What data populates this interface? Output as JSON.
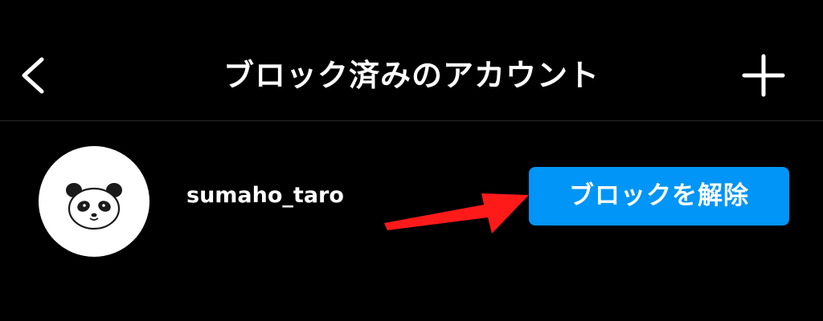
{
  "header": {
    "title": "ブロック済みのアカウント",
    "back_icon": "chevron-left-icon",
    "add_icon": "plus-icon"
  },
  "blocked_accounts": [
    {
      "username": "sumaho_taro",
      "avatar_icon": "panda-avatar",
      "action_label": "ブロックを解除"
    }
  ],
  "colors": {
    "background": "#000000",
    "text": "#ffffff",
    "button": "#0095f6",
    "annotation_arrow": "#ff1a1a"
  }
}
